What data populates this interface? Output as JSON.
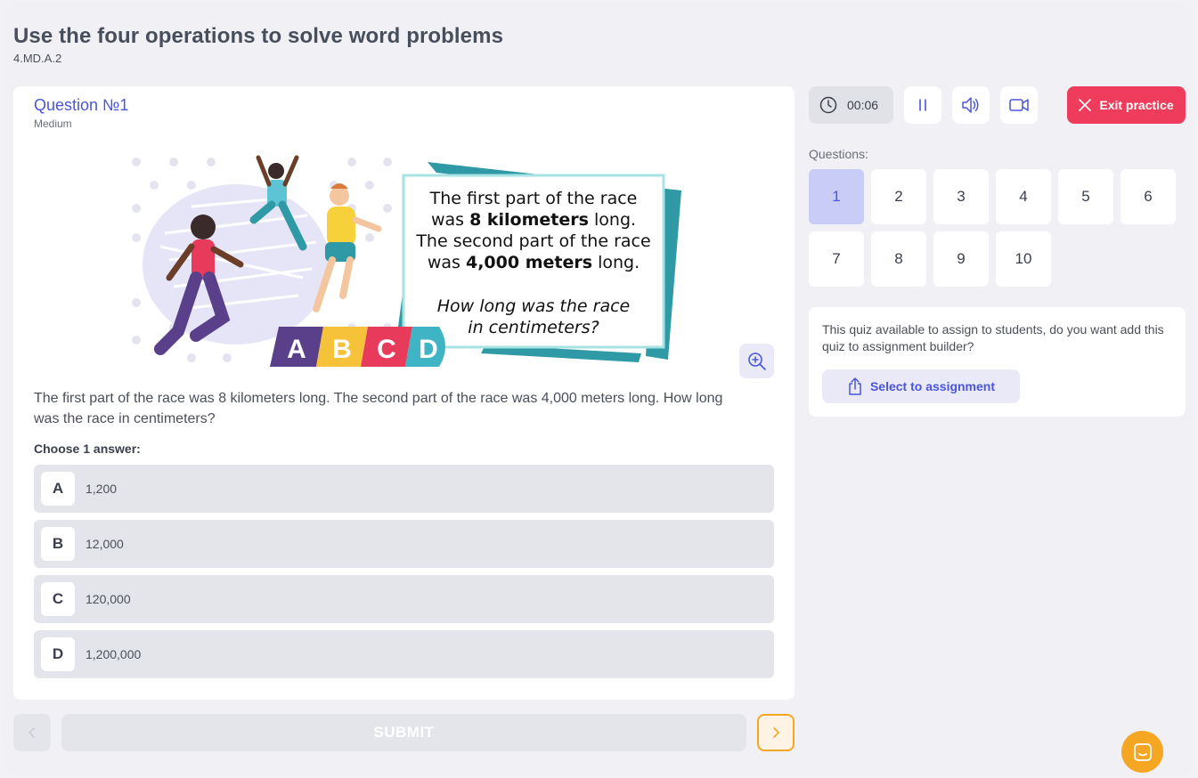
{
  "header": {
    "title": "Use the four operations to solve word problems",
    "code": "4.MD.A.2"
  },
  "question": {
    "title": "Question №1",
    "level": "Medium",
    "text": "The first part of the race was 8 kilometers long. The second part of the race was 4,000 meters long. How long was the race in centimeters?",
    "choose_label": "Choose 1 answer:",
    "answers": [
      {
        "letter": "A",
        "value": "1,200"
      },
      {
        "letter": "B",
        "value": "12,000"
      },
      {
        "letter": "C",
        "value": "120,000"
      },
      {
        "letter": "D",
        "value": "1,200,000"
      }
    ]
  },
  "illustration": {
    "line1": "The first part of the race",
    "line2a": "was ",
    "line2b": "8 kilometers",
    "line2c": " long.",
    "line3": "The second part of the race",
    "line4a": "was ",
    "line4b": "4,000 meters",
    "line4c": " long.",
    "line5": "How long was the race",
    "line6": "in centimeters?",
    "badges": [
      "A",
      "B",
      "C",
      "D"
    ]
  },
  "nav": {
    "submit_label": "SUBMIT"
  },
  "toolbar": {
    "timer": "00:06",
    "exit_label": "Exit practice"
  },
  "questions_panel": {
    "label": "Questions:",
    "numbers": [
      "1",
      "2",
      "3",
      "4",
      "5",
      "6",
      "7",
      "8",
      "9",
      "10"
    ],
    "active": "1"
  },
  "assignment": {
    "text": "This quiz available to assign to students, do you want add this quiz to assignment builder?",
    "button_label": "Select to assignment"
  },
  "colors": {
    "accent": "#4a56d9",
    "exit": "#f03c5c",
    "next_border": "#f5a623",
    "chat": "#f5a623"
  }
}
